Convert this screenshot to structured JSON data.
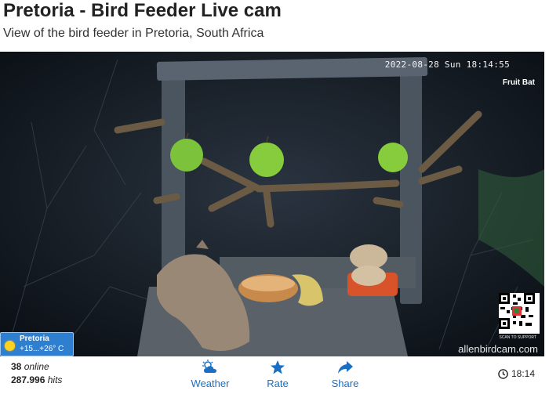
{
  "header": {
    "title": "Pretoria - Bird Feeder Live cam",
    "subtitle": "View of the bird feeder in Pretoria, South Africa"
  },
  "camera": {
    "timestamp": "2022-08-28 Sun 18:14:55",
    "label": "Fruit Bat",
    "watermark": "allenbirdcam.com",
    "qr_caption": "SCAN TO SUPPORT"
  },
  "weather_badge": {
    "city": "Pretoria",
    "temperature": "+15...+26° C",
    "icon": "sun-icon"
  },
  "footer": {
    "online_count": "38",
    "online_label": "online",
    "hits_count": "287.996",
    "hits_label": "hits",
    "actions": [
      {
        "label": "Weather",
        "icon": "weather-cloud-icon"
      },
      {
        "label": "Rate",
        "icon": "star-icon"
      },
      {
        "label": "Share",
        "icon": "share-arrow-icon"
      }
    ],
    "local_time": "18:14",
    "accent_color": "#1a6fc4"
  }
}
